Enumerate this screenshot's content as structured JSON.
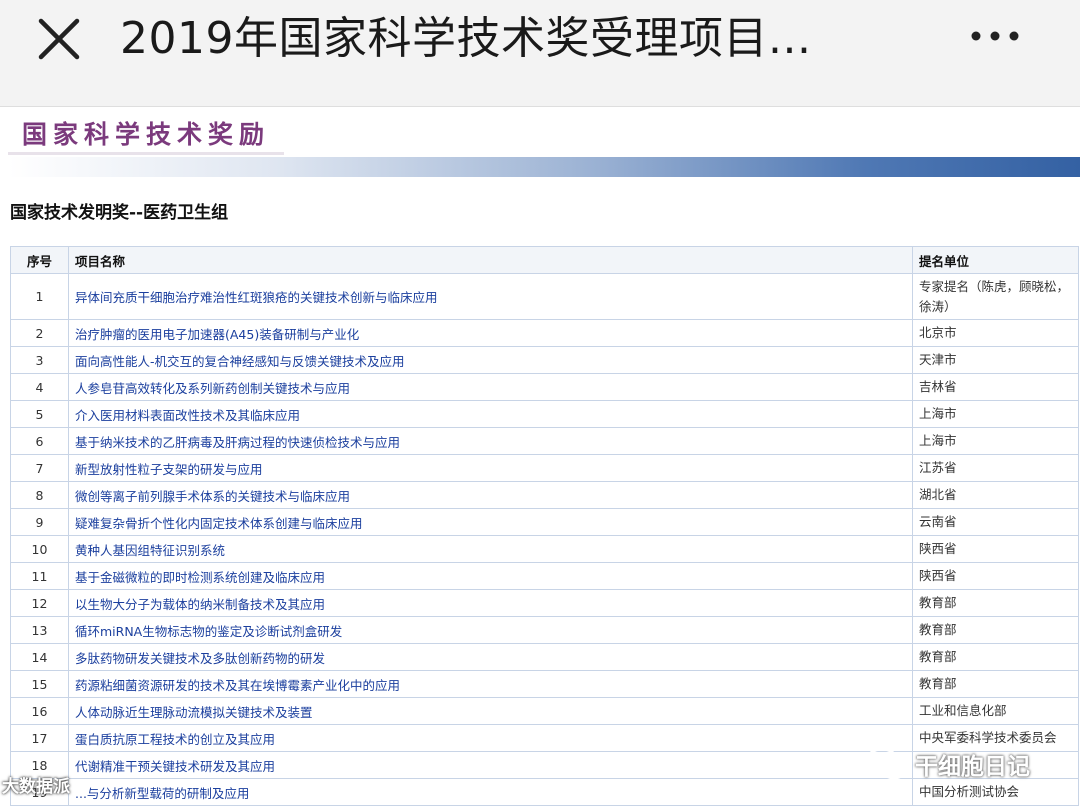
{
  "header": {
    "title": "2019年国家科学技术奖受理项目...",
    "close_icon": "close-icon",
    "more_icon": "more-horizontal-icon"
  },
  "banner": {
    "text": "国家科学技术奖励",
    "color": "#7b3a7d"
  },
  "section_title": "国家技术发明奖--医药卫生组",
  "table": {
    "headers": {
      "index": "序号",
      "name": "项目名称",
      "org": "提名单位"
    },
    "rows": [
      {
        "index": "1",
        "name": "异体间充质干细胞治疗难治性红斑狼疮的关键技术创新与临床应用",
        "org": "专家提名（陈虎，顾晓松，徐涛）"
      },
      {
        "index": "2",
        "name": "治疗肿瘤的医用电子加速器(A45)装备研制与产业化",
        "org": "北京市"
      },
      {
        "index": "3",
        "name": "面向高性能人-机交互的复合神经感知与反馈关键技术及应用",
        "org": "天津市"
      },
      {
        "index": "4",
        "name": "人参皂苷高效转化及系列新药创制关键技术与应用",
        "org": "吉林省"
      },
      {
        "index": "5",
        "name": "介入医用材料表面改性技术及其临床应用",
        "org": "上海市"
      },
      {
        "index": "6",
        "name": "基于纳米技术的乙肝病毒及肝病过程的快速侦检技术与应用",
        "org": "上海市"
      },
      {
        "index": "7",
        "name": "新型放射性粒子支架的研发与应用",
        "org": "江苏省"
      },
      {
        "index": "8",
        "name": "微创等离子前列腺手术体系的关键技术与临床应用",
        "org": "湖北省"
      },
      {
        "index": "9",
        "name": "疑难复杂骨折个性化内固定技术体系创建与临床应用",
        "org": "云南省"
      },
      {
        "index": "10",
        "name": "黄种人基因组特征识别系统",
        "org": "陕西省"
      },
      {
        "index": "11",
        "name": "基于金磁微粒的即时检测系统创建及临床应用",
        "org": "陕西省"
      },
      {
        "index": "12",
        "name": "以生物大分子为载体的纳米制备技术及其应用",
        "org": "教育部"
      },
      {
        "index": "13",
        "name": "循环miRNA生物标志物的鉴定及诊断试剂盒研发",
        "org": "教育部"
      },
      {
        "index": "14",
        "name": "多肽药物研发关键技术及多肽创新药物的研发",
        "org": "教育部"
      },
      {
        "index": "15",
        "name": "药源粘细菌资源研发的技术及其在埃博霉素产业化中的应用",
        "org": "教育部"
      },
      {
        "index": "16",
        "name": "人体动脉近生理脉动流模拟关键技术及装置",
        "org": "工业和信息化部"
      },
      {
        "index": "17",
        "name": "蛋白质抗原工程技术的创立及其应用",
        "org": "中央军委科学技术委员会"
      },
      {
        "index": "18",
        "name": "代谢精准干预关键技术研发及其应用",
        "org": ""
      },
      {
        "index": "19",
        "name": "...与分析新型载荷的研制及应用",
        "org": "中国分析测试协会"
      }
    ]
  },
  "watermark": {
    "text": "干细胞日记",
    "icon": "wechat-icon"
  },
  "left_watermark": "大数据派"
}
